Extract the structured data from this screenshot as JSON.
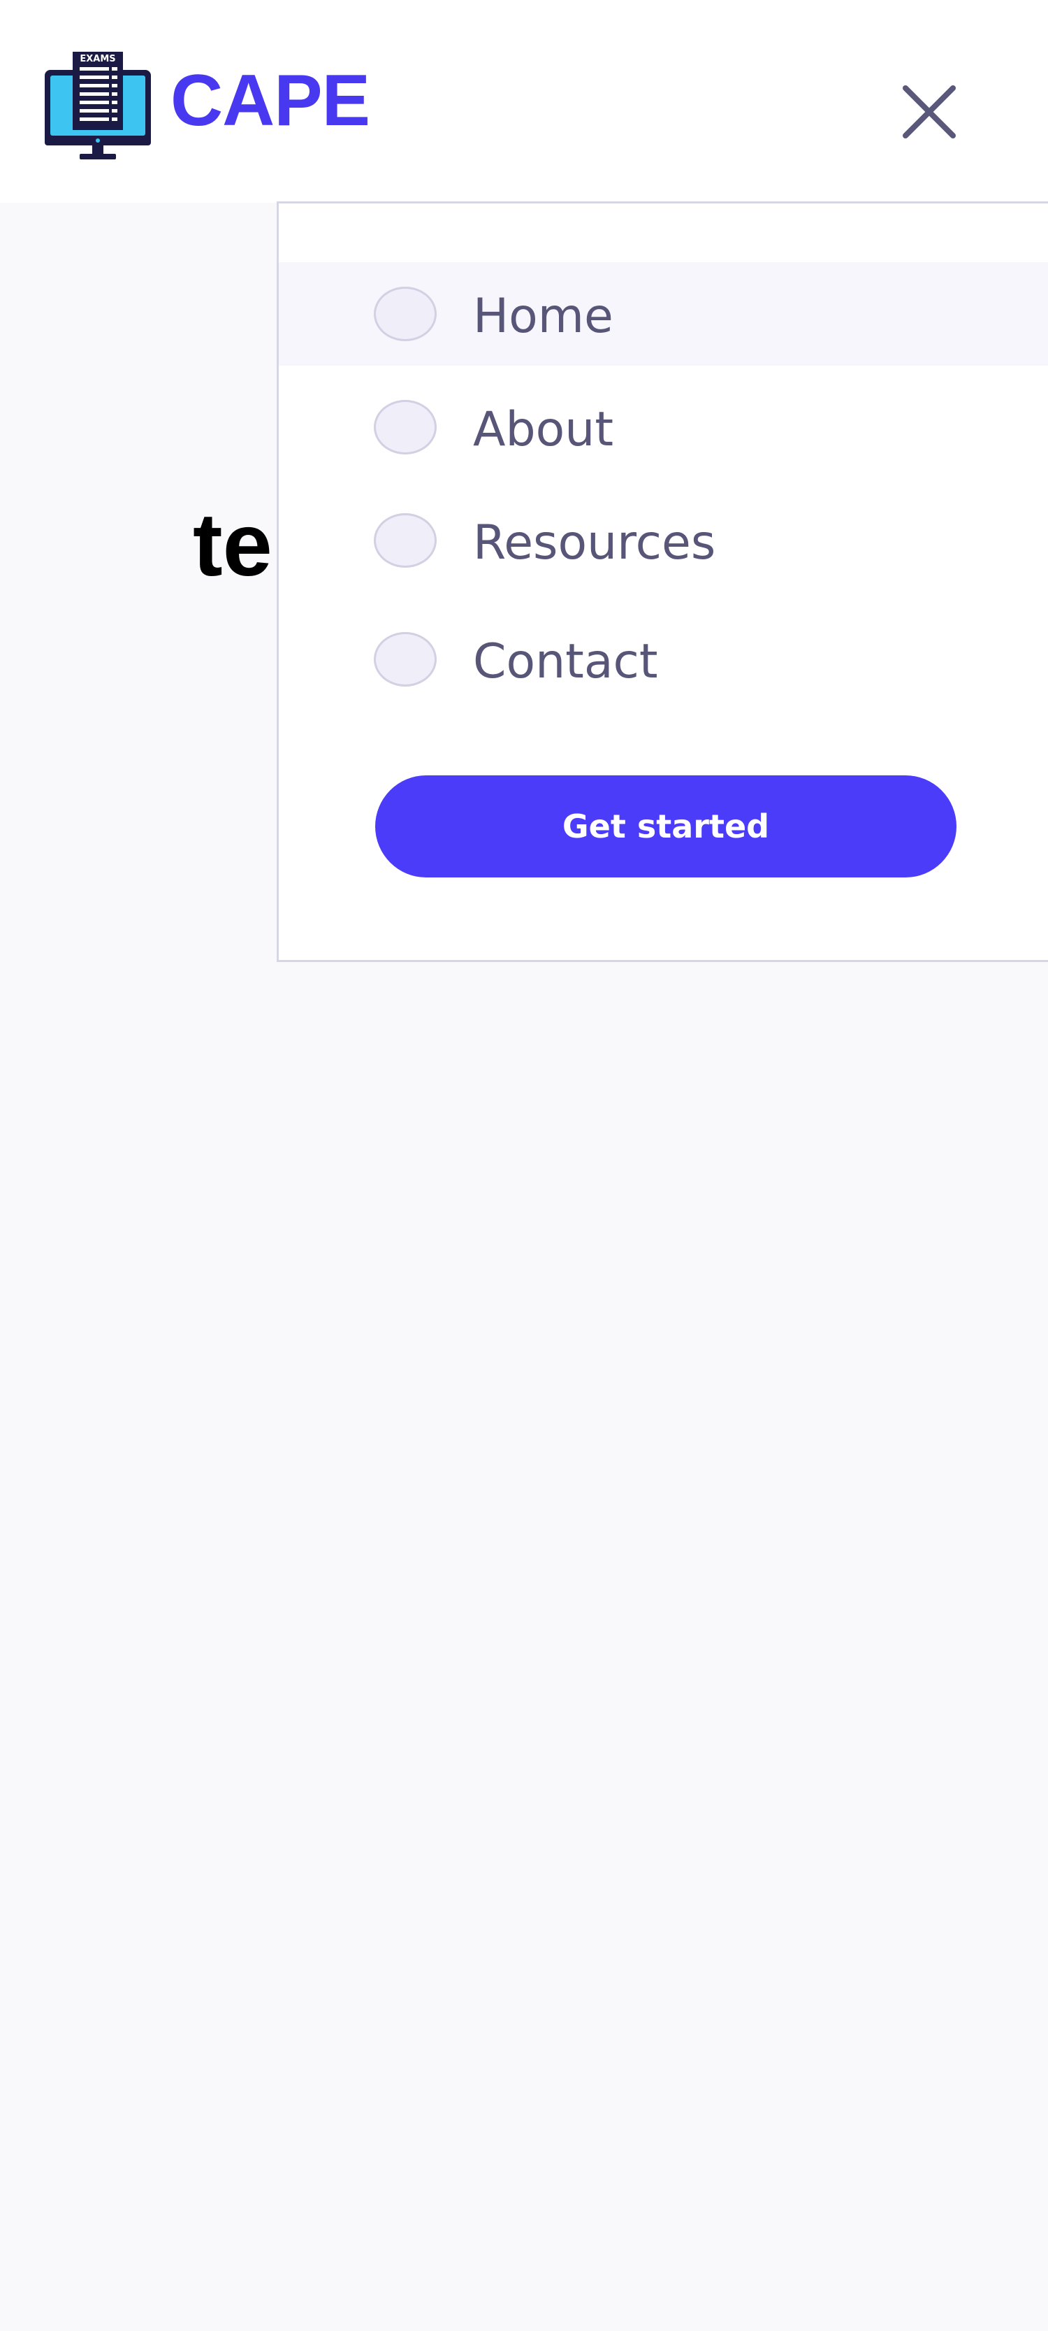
{
  "header": {
    "brand": "CAPE",
    "logo_text": "EXAMS",
    "logo_icon": "exam-monitor-icon",
    "close_icon": "close-icon"
  },
  "hero": {
    "partial_text": "te"
  },
  "menu": {
    "items": [
      {
        "label": "Home",
        "active": true
      },
      {
        "label": "About",
        "active": false
      },
      {
        "label": "Resources",
        "active": false
      },
      {
        "label": "Contact",
        "active": false
      }
    ],
    "cta_label": "Get started"
  },
  "colors": {
    "brand": "#4838f0",
    "cta": "#4a3cf8",
    "menu_text": "#585678",
    "page_bg": "#f9f9fb"
  }
}
